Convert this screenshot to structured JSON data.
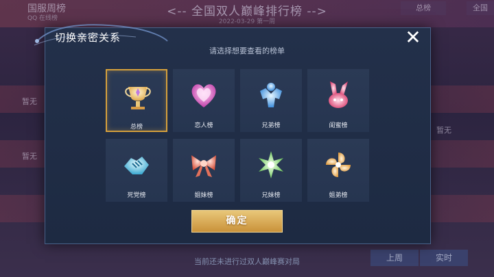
{
  "background": {
    "left_title": "国服周榜",
    "left_sub": "QQ 在线榜",
    "main_title": "<-- 全国双人巅峰排行榜 -->",
    "date": "2022-03-29 第一周",
    "tabs": [
      "总榜",
      "全国"
    ],
    "none_label": "暂无",
    "footer_text": "当前还未进行过双人巅峰赛对局",
    "footer_tabs": [
      "上周",
      "实时"
    ]
  },
  "dialog": {
    "title": "切换亲密关系",
    "subtitle": "请选择想要查看的榜单",
    "close_symbol": "✕",
    "confirm_label": "确定",
    "options": [
      {
        "label": "总榜",
        "icon": "trophy-icon",
        "selected": true
      },
      {
        "label": "恋人榜",
        "icon": "heart-icon",
        "selected": false
      },
      {
        "label": "兄弟榜",
        "icon": "brothers-icon",
        "selected": false
      },
      {
        "label": "闺蜜榜",
        "icon": "bunny-icon",
        "selected": false
      },
      {
        "label": "死党榜",
        "icon": "handshake-icon",
        "selected": false
      },
      {
        "label": "姐妹榜",
        "icon": "bow-icon",
        "selected": false
      },
      {
        "label": "兄妹榜",
        "icon": "flower-icon",
        "selected": false
      },
      {
        "label": "姐弟榜",
        "icon": "pinwheel-icon",
        "selected": false
      }
    ]
  },
  "colors": {
    "accent_gold": "#d7a13c",
    "dialog_bg": "#23304a",
    "card_bg": "#2b3a55"
  }
}
